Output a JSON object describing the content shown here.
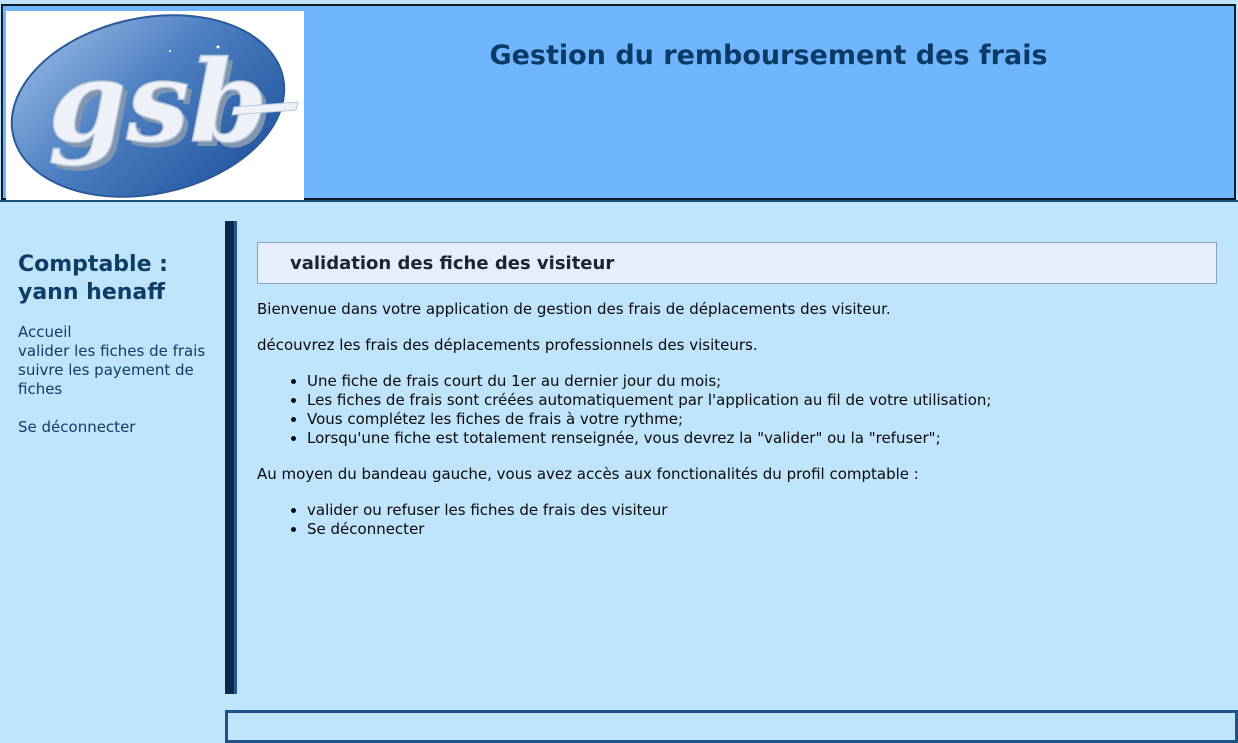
{
  "header": {
    "title": "Gestion du remboursement des frais",
    "logo_text": "gsb"
  },
  "sidebar": {
    "user_line1": "Comptable :",
    "user_line2": "yann henaff",
    "menu": [
      {
        "label": "Accueil"
      },
      {
        "label": "valider les fiches de frais"
      },
      {
        "label": "suivre les payement de fiches"
      }
    ],
    "logout": "Se déconnecter"
  },
  "main": {
    "title": "validation des fiche des visiteur",
    "intro1": "Bienvenue dans votre application de gestion des frais de déplacements des visiteur.",
    "intro2": "découvrez les frais des déplacements professionnels des visiteurs.",
    "rules": [
      "Une fiche de frais court du 1er au dernier jour du mois;",
      "Les fiches de frais sont créées automatiquement par l'application au fil de votre utilisation;",
      "Vous complétez les fiches de frais à votre rythme;",
      "Lorsqu'une fiche est totalement renseignée, vous devrez la \"valider\" ou la \"refuser\";"
    ],
    "intro3": "Au moyen du bandeau gauche, vous avez accès aux fonctionalités du profil comptable :",
    "features": [
      "valider ou refuser les fiches de frais des visiteur",
      "Se déconnecter"
    ]
  },
  "colors": {
    "header_bg": "#70b6fe",
    "page_bg": "#c0e4fc",
    "accent": "#0e3d66"
  }
}
